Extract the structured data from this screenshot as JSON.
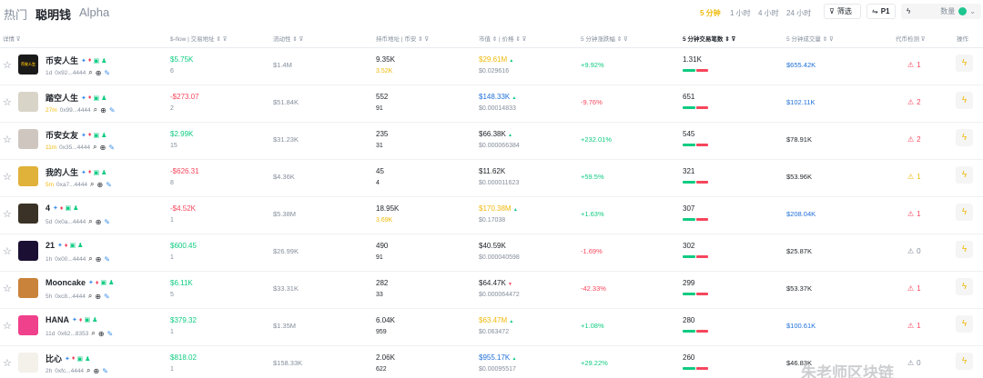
{
  "tabs": [
    "热门",
    "聪明钱",
    "Alpha"
  ],
  "active_tab": 1,
  "timeframes": [
    "5 分钟",
    "1 小时",
    "4 小时",
    "24 小时"
  ],
  "active_timeframe": 0,
  "filter_label": "筛选",
  "preset_label": "P1",
  "quantity_placeholder": "数量",
  "headers": {
    "details": "详情",
    "sflow": "$-flow",
    "trade_addr": "交易地址",
    "liquidity": "流动性",
    "holder_addr": "持币地址",
    "coin": "币安",
    "mcap": "市值",
    "price": "价格",
    "change": "5 分钟涨跌幅",
    "tx": "5 分钟交易笔数",
    "volume": "5 分钟成交量",
    "rug": "代币检测",
    "op": "操作"
  },
  "rows": [
    {
      "name": "币安人生",
      "age": "1d",
      "age_new": false,
      "addr": "0x92...4444",
      "sflow": "$5.75K",
      "sflow_dir": "up",
      "sflow_count": "6",
      "liquidity": "$1.4M",
      "holders": "9.35K",
      "holders2": "3.52K",
      "holders2_gold": true,
      "mcap": "$29.61M",
      "mcap_color": "gold",
      "mcap_arrow": "▲",
      "price": "$0.029616",
      "change": "+9.92%",
      "change_dir": "up",
      "tx": "1.31K",
      "tx_green": 14,
      "tx_red": 13,
      "volume": "$655.42K",
      "volume_color": "blue",
      "rug": "1",
      "rug_color": "red",
      "avatar_bg": "#1a1a1a",
      "avatar_text": "币安人生"
    },
    {
      "name": "踏空人生",
      "age": "27m",
      "age_new": true,
      "addr": "0x99...4444",
      "sflow": "-$273.07",
      "sflow_dir": "dn",
      "sflow_count": "2",
      "liquidity": "$51.84K",
      "holders": "552",
      "holders2": "91",
      "holders2_gold": false,
      "mcap": "$148.33K",
      "mcap_color": "blue",
      "mcap_arrow": "▲",
      "price": "$0.00014833",
      "change": "-9.76%",
      "change_dir": "dn",
      "tx": "651",
      "tx_green": 14,
      "tx_red": 13,
      "volume": "$102.11K",
      "volume_color": "blue",
      "rug": "2",
      "rug_color": "red",
      "avatar_bg": "#d9d4c8",
      "avatar_text": ""
    },
    {
      "name": "币安女友",
      "age": "11m",
      "age_new": true,
      "addr": "0x35...4444",
      "sflow": "$2.99K",
      "sflow_dir": "up",
      "sflow_count": "15",
      "liquidity": "$31.23K",
      "holders": "235",
      "holders2": "31",
      "holders2_gold": false,
      "mcap": "$66.38K",
      "mcap_color": "dark",
      "mcap_arrow": "▲",
      "price": "$0.000066384",
      "change": "+232.01%",
      "change_dir": "up",
      "tx": "545",
      "tx_green": 14,
      "tx_red": 13,
      "volume": "$78.91K",
      "volume_color": "dark",
      "rug": "2",
      "rug_color": "red",
      "avatar_bg": "#cfc6c0",
      "avatar_text": ""
    },
    {
      "name": "我的人生",
      "age": "5m",
      "age_new": true,
      "addr": "0xa7...4444",
      "sflow": "-$626.31",
      "sflow_dir": "dn",
      "sflow_count": "8",
      "liquidity": "$4.36K",
      "holders": "45",
      "holders2": "4",
      "holders2_gold": false,
      "mcap": "$11.62K",
      "mcap_color": "dark",
      "mcap_arrow": "",
      "price": "$0.000011623",
      "change": "+59.5%",
      "change_dir": "up",
      "tx": "321",
      "tx_green": 14,
      "tx_red": 13,
      "volume": "$53.96K",
      "volume_color": "dark",
      "rug": "1",
      "rug_color": "gold",
      "avatar_bg": "#e0b23a",
      "avatar_text": ""
    },
    {
      "name": "4",
      "age": "5d",
      "age_new": false,
      "addr": "0x0a...4444",
      "sflow": "-$4.52K",
      "sflow_dir": "dn",
      "sflow_count": "1",
      "liquidity": "$5.38M",
      "holders": "18.95K",
      "holders2": "3.69K",
      "holders2_gold": true,
      "mcap": "$170.38M",
      "mcap_color": "gold",
      "mcap_arrow": "▲",
      "price": "$0.17038",
      "change": "+1.63%",
      "change_dir": "up",
      "tx": "307",
      "tx_green": 14,
      "tx_red": 13,
      "volume": "$208.04K",
      "volume_color": "blue",
      "rug": "1",
      "rug_color": "red",
      "avatar_bg": "#3a3226",
      "avatar_text": ""
    },
    {
      "name": "21",
      "age": "1h",
      "age_new": false,
      "addr": "0x00...4444",
      "sflow": "$600.45",
      "sflow_dir": "up",
      "sflow_count": "1",
      "liquidity": "$26.99K",
      "holders": "490",
      "holders2": "91",
      "holders2_gold": false,
      "mcap": "$40.59K",
      "mcap_color": "dark",
      "mcap_arrow": "",
      "price": "$0.000040598",
      "change": "-1.69%",
      "change_dir": "dn",
      "tx": "302",
      "tx_green": 14,
      "tx_red": 13,
      "volume": "$25.87K",
      "volume_color": "dark",
      "rug": "0",
      "rug_color": "grey",
      "avatar_bg": "#1b1033",
      "avatar_text": ""
    },
    {
      "name": "Mooncake",
      "age": "5h",
      "age_new": false,
      "addr": "0xc8...4444",
      "sflow": "$6.11K",
      "sflow_dir": "up",
      "sflow_count": "5",
      "liquidity": "$33.31K",
      "holders": "282",
      "holders2": "33",
      "holders2_gold": false,
      "mcap": "$64.47K",
      "mcap_color": "dark",
      "mcap_arrow": "▼",
      "price": "$0.000064472",
      "change": "-42.33%",
      "change_dir": "dn",
      "tx": "299",
      "tx_green": 14,
      "tx_red": 13,
      "volume": "$53.37K",
      "volume_color": "dark",
      "rug": "1",
      "rug_color": "red",
      "avatar_bg": "#c9833a",
      "avatar_text": ""
    },
    {
      "name": "HANA",
      "age": "11d",
      "age_new": false,
      "addr": "0x62...8353",
      "sflow": "$379.32",
      "sflow_dir": "up",
      "sflow_count": "1",
      "liquidity": "$1.35M",
      "holders": "6.04K",
      "holders2": "959",
      "holders2_gold": false,
      "mcap": "$63.47M",
      "mcap_color": "gold",
      "mcap_arrow": "▲",
      "price": "$0.063472",
      "change": "+1.08%",
      "change_dir": "up",
      "tx": "280",
      "tx_green": 14,
      "tx_red": 13,
      "volume": "$100.61K",
      "volume_color": "blue",
      "rug": "1",
      "rug_color": "red",
      "avatar_bg": "#f0418c",
      "avatar_text": ""
    },
    {
      "name": "比心",
      "age": "2h",
      "age_new": false,
      "addr": "0xfc...4444",
      "sflow": "$818.02",
      "sflow_dir": "up",
      "sflow_count": "1",
      "liquidity": "$158.33K",
      "holders": "2.06K",
      "holders2": "622",
      "holders2_gold": false,
      "mcap": "$955.17K",
      "mcap_color": "blue",
      "mcap_arrow": "▲",
      "price": "$0.00095517",
      "change": "+29.22%",
      "change_dir": "up",
      "tx": "260",
      "tx_green": 14,
      "tx_red": 13,
      "volume": "$46.83K",
      "volume_color": "dark",
      "rug": "0",
      "rug_color": "grey",
      "avatar_bg": "#f4f1ea",
      "avatar_text": ""
    }
  ],
  "watermark": "朱老师区块链",
  "icons": {
    "star": "star-icon",
    "search": "search-icon",
    "globe": "globe-icon",
    "bolt": "bolt-icon",
    "filter": "filter-icon",
    "warn": "warning-icon"
  },
  "colors": {
    "up": "#0ecb81",
    "down": "#f6465d",
    "accent": "#f0b90b",
    "blue": "#1e6fd9"
  }
}
